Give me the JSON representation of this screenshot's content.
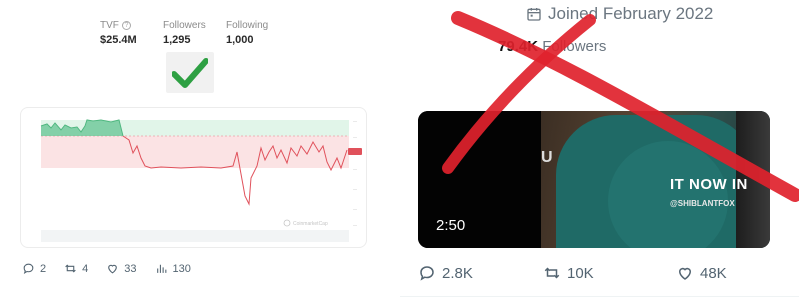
{
  "left_profile": {
    "stats": [
      {
        "label": "TVF",
        "value": "$25.4M",
        "has_info": true
      },
      {
        "label": "Followers",
        "value": "1,295",
        "has_info": false
      },
      {
        "label": "Following",
        "value": "1,000",
        "has_info": false
      }
    ],
    "verification_mark": "check-icon"
  },
  "left_post": {
    "actions": {
      "replies": "2",
      "reposts": "4",
      "likes": "33",
      "views": "130"
    },
    "chart_watermark": "CoinmarketCap",
    "colors": {
      "above": "#5bc08b",
      "below": "#e8838a",
      "fill_above": "#c9ecd7",
      "fill_below": "#fbe3e4"
    }
  },
  "right_profile": {
    "joined": "Joined February 2022",
    "followers_count": "79.4K",
    "followers_label": "Followers"
  },
  "right_post": {
    "video": {
      "duration": "2:50",
      "overlay_text": "IT NOW IN",
      "overlay_handle": "@SHIBLANTFOX",
      "side_letters": "U"
    },
    "actions": {
      "replies": "2.8K",
      "reposts": "10K",
      "likes": "48K"
    }
  },
  "overlay": {
    "cross_color": "#e0222c"
  }
}
